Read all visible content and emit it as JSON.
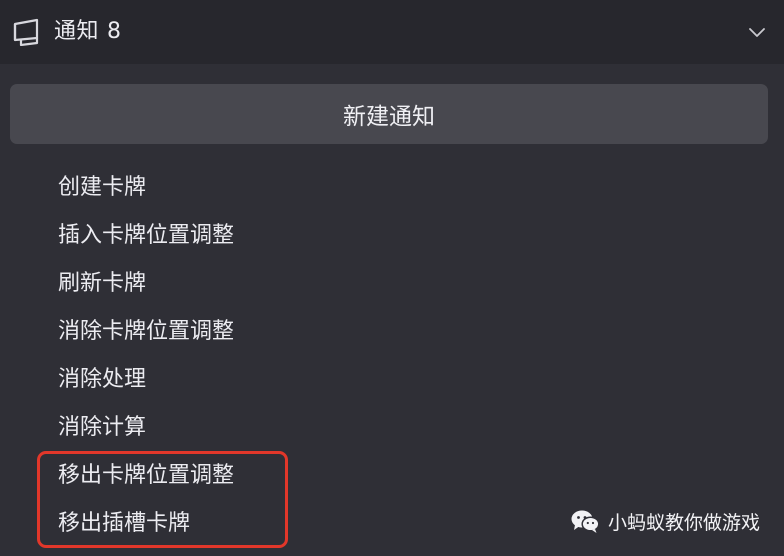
{
  "header": {
    "title": "通知",
    "count": "8",
    "icon": "notice-board-icon",
    "collapse_icon": "chevron-down-icon"
  },
  "new_button": {
    "label": "新建通知"
  },
  "notifications": [
    "创建卡牌",
    "插入卡牌位置调整",
    "刷新卡牌",
    "消除卡牌位置调整",
    "消除处理",
    "消除计算",
    "移出卡牌位置调整",
    "移出插槽卡牌"
  ],
  "annotation": {
    "color": "#e2372a"
  },
  "watermark": {
    "text": "小蚂蚁教你做游戏",
    "icon": "wechat-icon"
  },
  "colors": {
    "background": "#2f2f36",
    "header_background": "#27272d",
    "button_background": "#48484f",
    "text": "#ececf1"
  }
}
